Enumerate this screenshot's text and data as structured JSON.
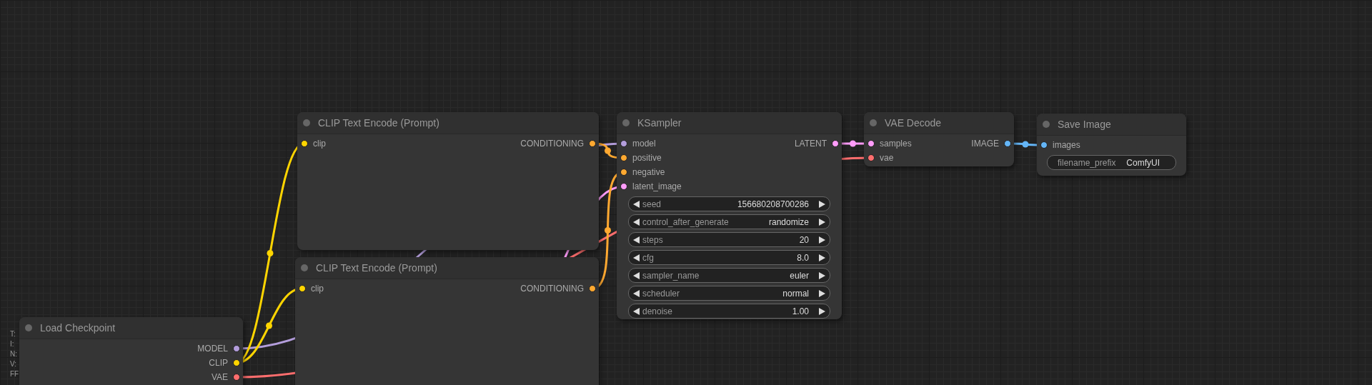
{
  "stats": [
    "T:",
    "I:",
    "N:",
    "V:",
    "FF"
  ],
  "nodes": [
    {
      "title": "Load Checkpoint",
      "outputs": [
        {
          "name": "MODEL",
          "color": "#b39ddb"
        },
        {
          "name": "CLIP",
          "color": "#ffd500"
        },
        {
          "name": "VAE",
          "color": "#ff6e6e"
        }
      ]
    },
    {
      "title": "CLIP Text Encode (Prompt)",
      "inputs": [
        {
          "name": "clip",
          "color": "#ffd500"
        }
      ],
      "outputs": [
        {
          "name": "CONDITIONING",
          "color": "#ffa931"
        }
      ]
    },
    {
      "title": "CLIP Text Encode (Prompt)",
      "inputs": [
        {
          "name": "clip",
          "color": "#ffd500"
        }
      ],
      "outputs": [
        {
          "name": "CONDITIONING",
          "color": "#ffa931"
        }
      ]
    },
    {
      "title": "KSampler",
      "inputs": [
        {
          "name": "model",
          "color": "#b39ddb"
        },
        {
          "name": "positive",
          "color": "#ffa931"
        },
        {
          "name": "negative",
          "color": "#ffa931"
        },
        {
          "name": "latent_image",
          "color": "#ff9cf9"
        }
      ],
      "outputs": [
        {
          "name": "LATENT",
          "color": "#ff9cf9"
        }
      ],
      "widgets": [
        {
          "kind": "number",
          "label": "seed",
          "value": "156680208700286"
        },
        {
          "kind": "combo",
          "label": "control_after_generate",
          "value": "randomize"
        },
        {
          "kind": "number",
          "label": "steps",
          "value": "20"
        },
        {
          "kind": "number",
          "label": "cfg",
          "value": "8.0"
        },
        {
          "kind": "combo",
          "label": "sampler_name",
          "value": "euler"
        },
        {
          "kind": "combo",
          "label": "scheduler",
          "value": "normal"
        },
        {
          "kind": "number",
          "label": "denoise",
          "value": "1.00"
        }
      ]
    },
    {
      "title": "VAE Decode",
      "inputs": [
        {
          "name": "samples",
          "color": "#ff9cf9"
        },
        {
          "name": "vae",
          "color": "#ff6e6e"
        }
      ],
      "outputs": [
        {
          "name": "IMAGE",
          "color": "#64b5f6"
        }
      ]
    },
    {
      "title": "Save Image",
      "inputs": [
        {
          "name": "images",
          "color": "#64b5f6"
        }
      ],
      "widgets": [
        {
          "kind": "text",
          "label": "filename_prefix",
          "value": "ComfyUI"
        }
      ]
    }
  ]
}
